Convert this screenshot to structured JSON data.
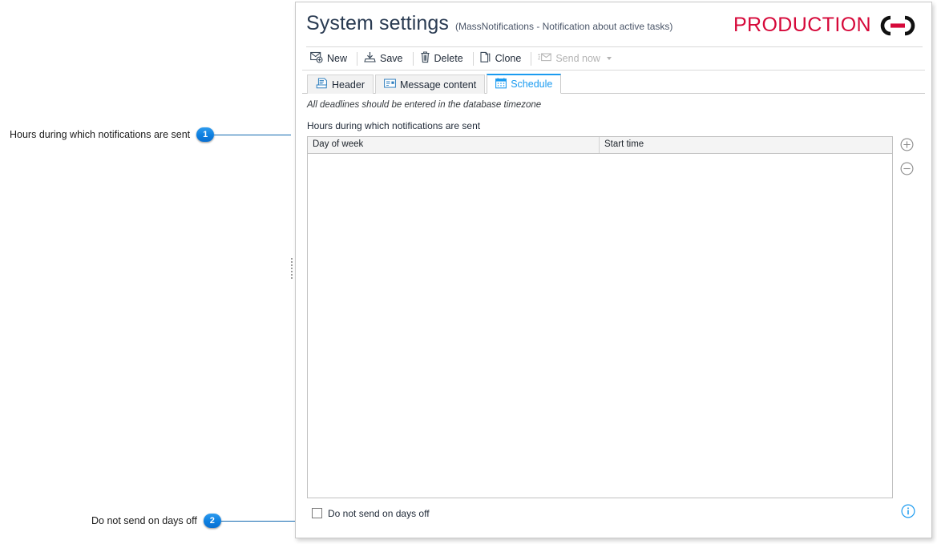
{
  "window": {
    "title": "System settings",
    "subtitle": "(MassNotifications - Notification about active tasks)",
    "logo": {
      "word": "PRODUCTION",
      "mark_name": "interlocking-rings-logo",
      "color": "#d6093a",
      "mark_color": "#111111"
    }
  },
  "toolbar": {
    "items": [
      {
        "label": "New",
        "icon": "new-mail-icon",
        "disabled": false,
        "has_caret": false
      },
      {
        "label": "Save",
        "icon": "save-icon",
        "disabled": false,
        "has_caret": false
      },
      {
        "label": "Delete",
        "icon": "trash-icon",
        "disabled": false,
        "has_caret": false
      },
      {
        "label": "Clone",
        "icon": "copy-page-icon",
        "disabled": false,
        "has_caret": false
      },
      {
        "label": "Send now",
        "icon": "send-mail-icon",
        "disabled": true,
        "has_caret": true
      }
    ]
  },
  "tabs": [
    {
      "label": "Header",
      "icon": "header-printer-icon",
      "active": false
    },
    {
      "label": "Message content",
      "icon": "message-content-icon",
      "active": false
    },
    {
      "label": "Schedule",
      "icon": "calendar-icon",
      "active": true
    }
  ],
  "schedule_tab": {
    "timezone_note": "All deadlines should be entered in the database timezone",
    "hours_label": "Hours during which notifications are sent",
    "grid": {
      "columns": [
        "Day of week",
        "Start time"
      ],
      "rows": []
    },
    "grid_tools": [
      {
        "name": "add-row-button",
        "glyph": "⊕"
      },
      {
        "name": "remove-row-button",
        "glyph": "⊖"
      }
    ],
    "days_off_checkbox": {
      "label": "Do not send on days off",
      "checked": false
    },
    "info_icon": {
      "name": "info-icon",
      "color": "#1b9bf0"
    }
  },
  "annotations": [
    {
      "number": "1",
      "text": "Hours during which notifications are sent"
    },
    {
      "number": "2",
      "text": "Do not send on days off"
    }
  ]
}
